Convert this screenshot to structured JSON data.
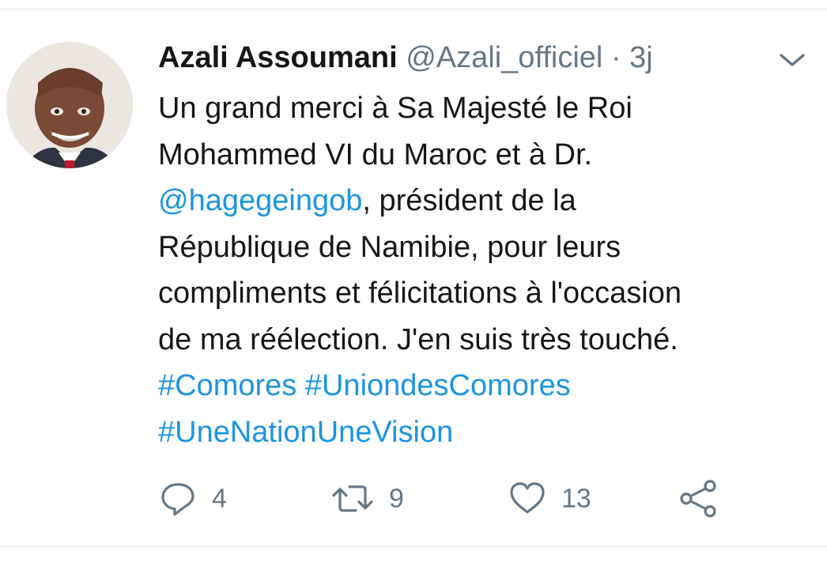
{
  "tweet": {
    "author": {
      "display_name": "Azali Assoumani",
      "handle": "@Azali_officiel",
      "separator": "·",
      "time": "3j"
    },
    "text_lines": [
      [
        {
          "text": "Un grand merci à Sa Majesté le Roi",
          "type": "text"
        }
      ],
      [
        {
          "text": "Mohammed VI du Maroc et à Dr.",
          "type": "text"
        }
      ],
      [
        {
          "text": "@hagegeingob",
          "type": "link"
        },
        {
          "text": ", président de la",
          "type": "text"
        }
      ],
      [
        {
          "text": "République de Namibie, pour leurs",
          "type": "text"
        }
      ],
      [
        {
          "text": "compliments et félicitations à l'occasion",
          "type": "text"
        }
      ],
      [
        {
          "text": "de ma réélection. J'en suis très touché.",
          "type": "text"
        }
      ],
      [
        {
          "text": "#Comores",
          "type": "link"
        },
        {
          "text": " ",
          "type": "text"
        },
        {
          "text": "#UniondesComores",
          "type": "link"
        }
      ],
      [
        {
          "text": "#UneNationUneVision",
          "type": "link"
        }
      ]
    ],
    "actions": {
      "reply": {
        "icon": "reply-icon",
        "count": "4"
      },
      "retweet": {
        "icon": "retweet-icon",
        "count": "9"
      },
      "like": {
        "icon": "heart-icon",
        "count": "13"
      },
      "share": {
        "icon": "share-icon"
      }
    },
    "menu_icon": "chevron-down-icon"
  },
  "colors": {
    "text": "#14171a",
    "secondary": "#657786",
    "link": "#1b95e0",
    "divider": "#e1e8ed",
    "background": "#ffffff"
  }
}
